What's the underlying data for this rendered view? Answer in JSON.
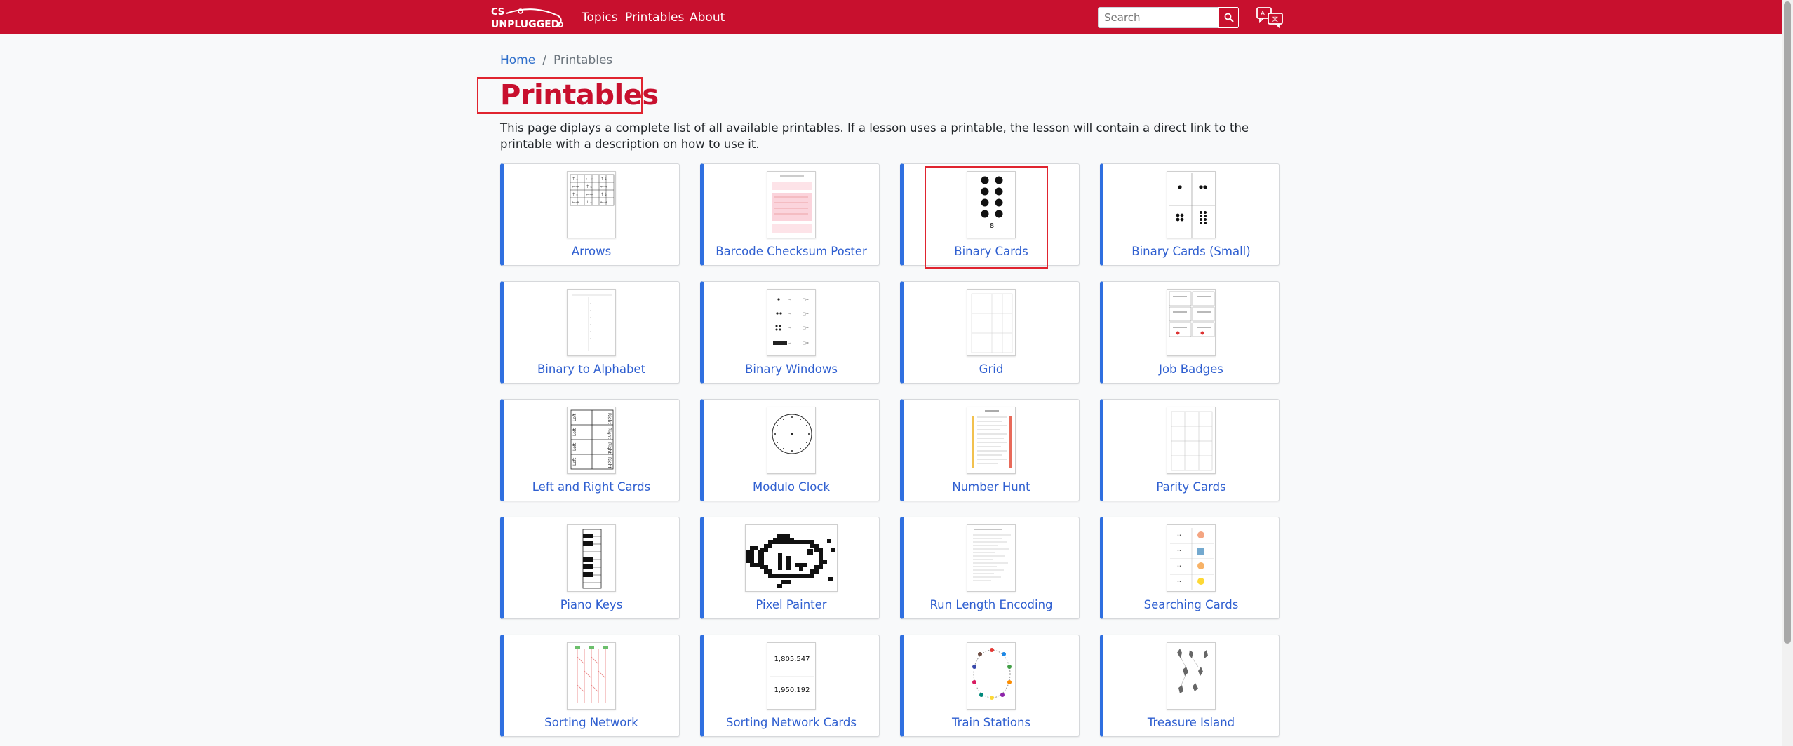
{
  "nav": {
    "logo_top": "CS",
    "logo_bottom": "UNPLUGGED",
    "links": [
      "Topics",
      "Printables",
      "About"
    ],
    "search_placeholder": "Search",
    "icons": [
      "search-icon",
      "language-icon"
    ],
    "brand_color": "#c8102e"
  },
  "breadcrumb": {
    "home": "Home",
    "sep": "/",
    "current": "Printables"
  },
  "page": {
    "title": "Printables",
    "intro": "This page diplays a complete list of all available printables. If a lesson uses a printable, the lesson will contain a direct link to the printable with a description on how to use it."
  },
  "printables": [
    {
      "label": "Arrows",
      "thumb": "arrows"
    },
    {
      "label": "Barcode Checksum Poster",
      "thumb": "barcode"
    },
    {
      "label": "Binary Cards",
      "thumb": "binary"
    },
    {
      "label": "Binary Cards (Small)",
      "thumb": "binary-small"
    },
    {
      "label": "Binary to Alphabet",
      "thumb": "alphabet"
    },
    {
      "label": "Binary Windows",
      "thumb": "windows"
    },
    {
      "label": "Grid",
      "thumb": "grid"
    },
    {
      "label": "Job Badges",
      "thumb": "badges"
    },
    {
      "label": "Left and Right Cards",
      "thumb": "leftright"
    },
    {
      "label": "Modulo Clock",
      "thumb": "clock"
    },
    {
      "label": "Number Hunt",
      "thumb": "numberhunt"
    },
    {
      "label": "Parity Cards",
      "thumb": "parity"
    },
    {
      "label": "Piano Keys",
      "thumb": "piano"
    },
    {
      "label": "Pixel Painter",
      "thumb": "fish"
    },
    {
      "label": "Run Length Encoding",
      "thumb": "rle"
    },
    {
      "label": "Searching Cards",
      "thumb": "searching"
    },
    {
      "label": "Sorting Network",
      "thumb": "sortnet"
    },
    {
      "label": "Sorting Network Cards",
      "thumb": "sortcards"
    },
    {
      "label": "Train Stations",
      "thumb": "train"
    },
    {
      "label": "Treasure Island",
      "thumb": "treasure"
    }
  ],
  "thumb_text": {
    "binary_number": "8",
    "sort_card_1": "1,805,547",
    "sort_card_2": "1,950,192"
  },
  "colors": {
    "link": "#2f5fd0",
    "card_accent": "#2f6fe0",
    "highlight": "#e0242f"
  }
}
